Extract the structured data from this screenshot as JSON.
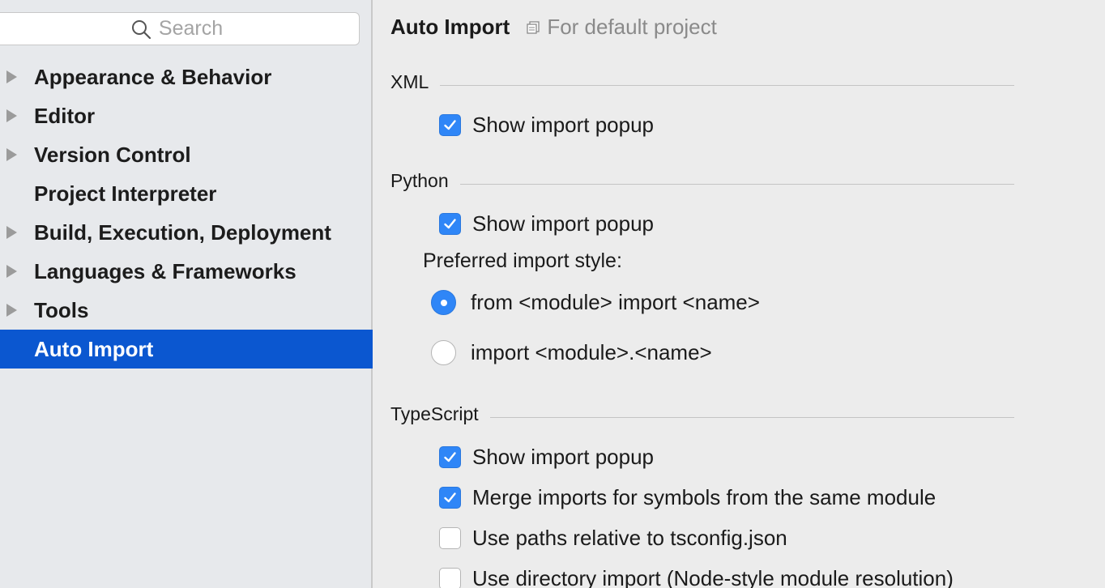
{
  "search": {
    "placeholder": "Search",
    "icon": "search-icon"
  },
  "sidebar": {
    "items": [
      {
        "label": "Appearance & Behavior",
        "expandable": true,
        "selected": false
      },
      {
        "label": "Editor",
        "expandable": true,
        "selected": false
      },
      {
        "label": "Version Control",
        "expandable": true,
        "selected": false
      },
      {
        "label": "Project Interpreter",
        "expandable": false,
        "selected": false
      },
      {
        "label": "Build, Execution, Deployment",
        "expandable": true,
        "selected": false
      },
      {
        "label": "Languages & Frameworks",
        "expandable": true,
        "selected": false
      },
      {
        "label": "Tools",
        "expandable": true,
        "selected": false
      },
      {
        "label": "Auto Import",
        "expandable": false,
        "selected": true
      }
    ]
  },
  "header": {
    "title": "Auto Import",
    "scope": "For default project",
    "scope_icon": "copy-icon"
  },
  "sections": {
    "xml": {
      "title": "XML",
      "show_popup": {
        "label": "Show import popup",
        "checked": true
      }
    },
    "python": {
      "title": "Python",
      "show_popup": {
        "label": "Show import popup",
        "checked": true
      },
      "style_label": "Preferred import style:",
      "style_options": [
        {
          "label": "from <module> import <name>",
          "selected": true
        },
        {
          "label": "import <module>.<name>",
          "selected": false
        }
      ]
    },
    "typescript": {
      "title": "TypeScript",
      "options": [
        {
          "label": "Show import popup",
          "checked": true
        },
        {
          "label": "Merge imports for symbols from the same module",
          "checked": true
        },
        {
          "label": "Use paths relative to tsconfig.json",
          "checked": false
        },
        {
          "label": "Use directory import (Node-style module resolution)",
          "checked": false
        }
      ]
    }
  },
  "colors": {
    "accent": "#2f86f7",
    "selection": "#0b57d0",
    "sidebar_bg": "#e7e9ec",
    "panel_bg": "#ececec"
  }
}
